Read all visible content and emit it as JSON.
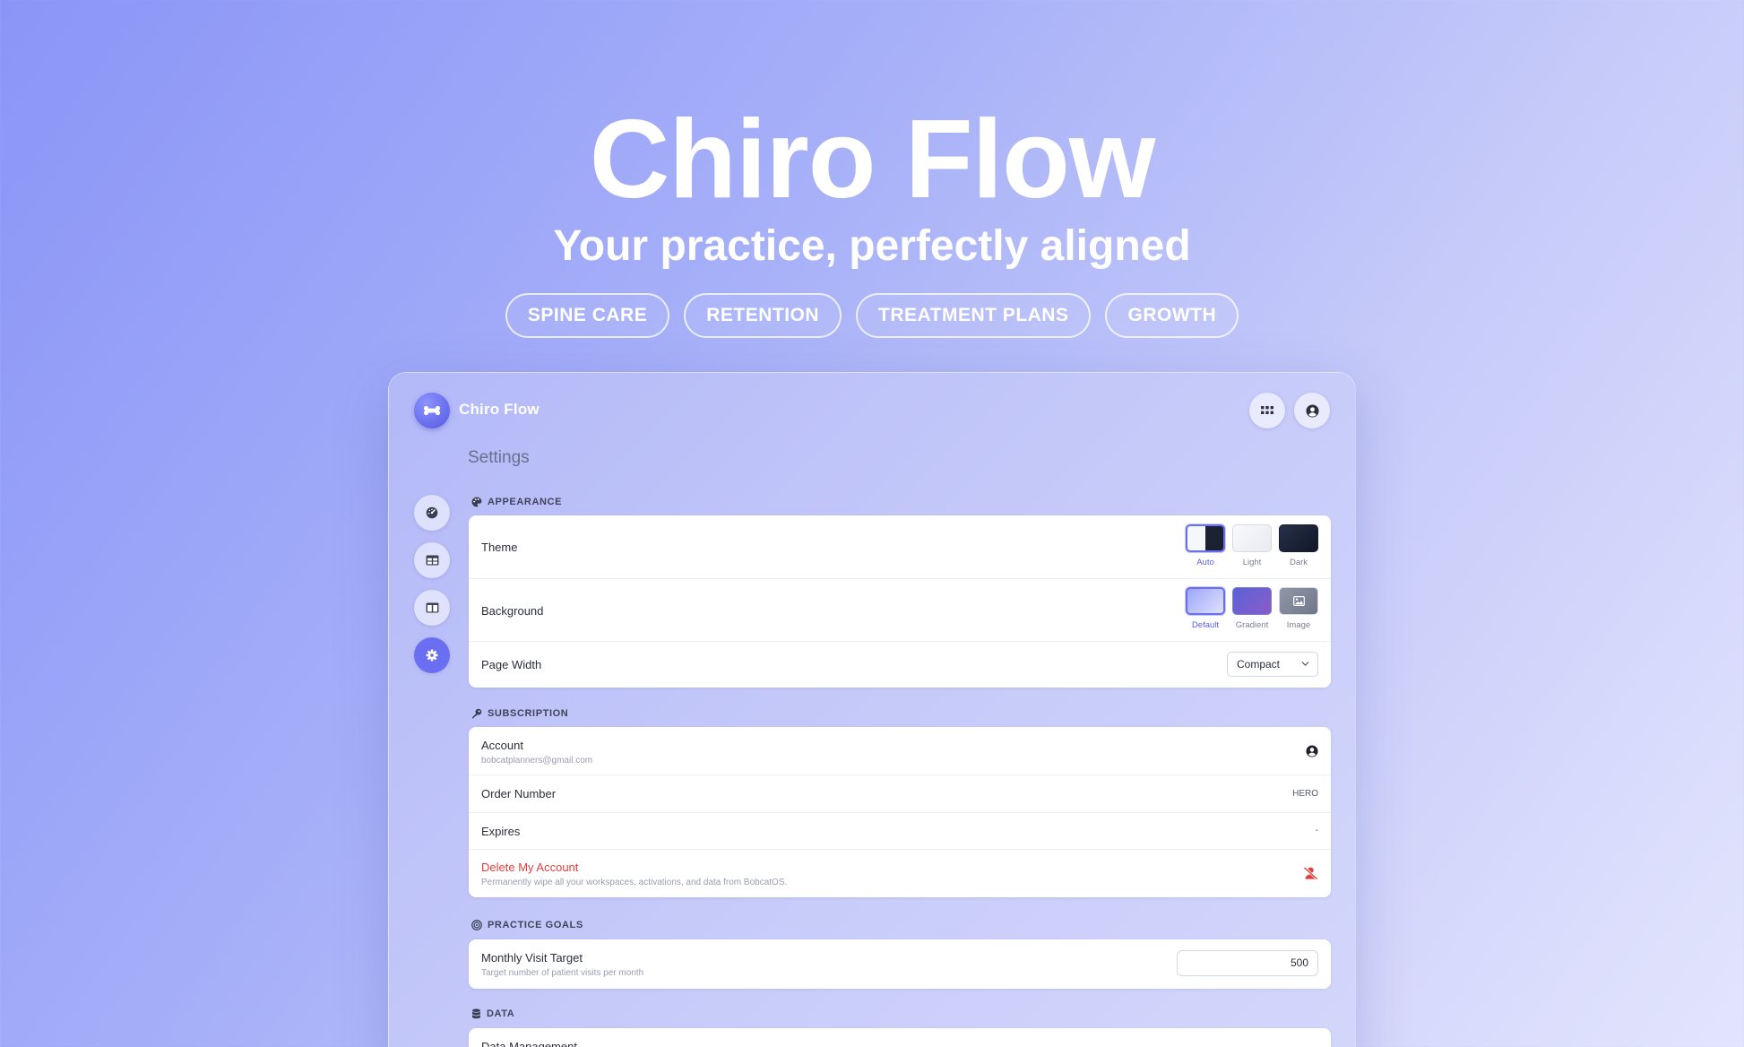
{
  "hero": {
    "title": "Chiro Flow",
    "subtitle": "Your practice, perfectly aligned",
    "tags": [
      "SPINE CARE",
      "RETENTION",
      "TREATMENT PLANS",
      "GROWTH"
    ]
  },
  "app": {
    "name": "Chiro Flow",
    "logo_icon": "bone-icon",
    "top_actions": [
      {
        "icon": "grid-icon"
      },
      {
        "icon": "account-circle-icon"
      }
    ],
    "sidebar": [
      {
        "icon": "dashboard-gauge-icon",
        "active": false
      },
      {
        "icon": "table-icon",
        "active": false
      },
      {
        "icon": "columns-icon",
        "active": false
      },
      {
        "icon": "gear-icon",
        "active": true
      }
    ],
    "page_title": "Settings",
    "accent_color": "#6a6ef0",
    "danger_color": "#e53e3e"
  },
  "appearance": {
    "header": "APPEARANCE",
    "theme": {
      "label": "Theme",
      "options": [
        "Auto",
        "Light",
        "Dark"
      ],
      "selected": "Auto"
    },
    "background": {
      "label": "Background",
      "options": [
        "Default",
        "Gradient",
        "Image"
      ],
      "selected": "Default"
    },
    "page_width": {
      "label": "Page Width",
      "value": "Compact"
    }
  },
  "subscription": {
    "header": "SUBSCRIPTION",
    "account": {
      "label": "Account",
      "email": "bobcatplanners@gmail.com"
    },
    "order": {
      "label": "Order Number",
      "value": "HERO"
    },
    "expires": {
      "label": "Expires",
      "value": "-"
    },
    "delete": {
      "label": "Delete My Account",
      "description": "Permanently wipe all your workspaces, activations, and data from BobcatOS."
    }
  },
  "practice_goals": {
    "header": "PRACTICE GOALS",
    "monthly_visit_target": {
      "label": "Monthly Visit Target",
      "description": "Target number of patient visits per month",
      "value": "500"
    }
  },
  "data_section": {
    "header": "DATA",
    "first_row_label": "Data Management"
  }
}
